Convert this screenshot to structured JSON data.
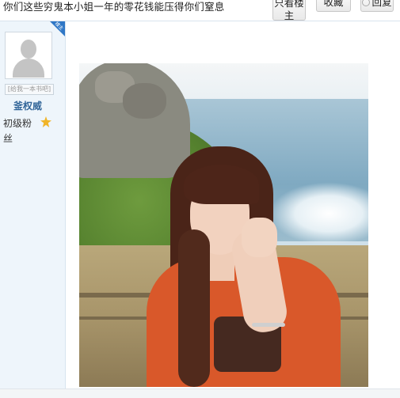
{
  "thread": {
    "title": "你们这些穷鬼本小姐一年的零花钱能压得你们窒息"
  },
  "toolbar": {
    "only_op_label": "只看楼主",
    "favorite_label": "收藏",
    "reply_label": "回复"
  },
  "user": {
    "badge": "楼主",
    "name_box": "[给我一本书吧]",
    "username": "釜权威",
    "level": "初级粉丝",
    "level_icon": "star-badge-icon"
  },
  "post": {
    "image_icon": "photo-girl-seaside"
  },
  "colors": {
    "sidebar_bg": "#eef5fb",
    "username": "#336699",
    "ribbon": "#2f77c6"
  }
}
